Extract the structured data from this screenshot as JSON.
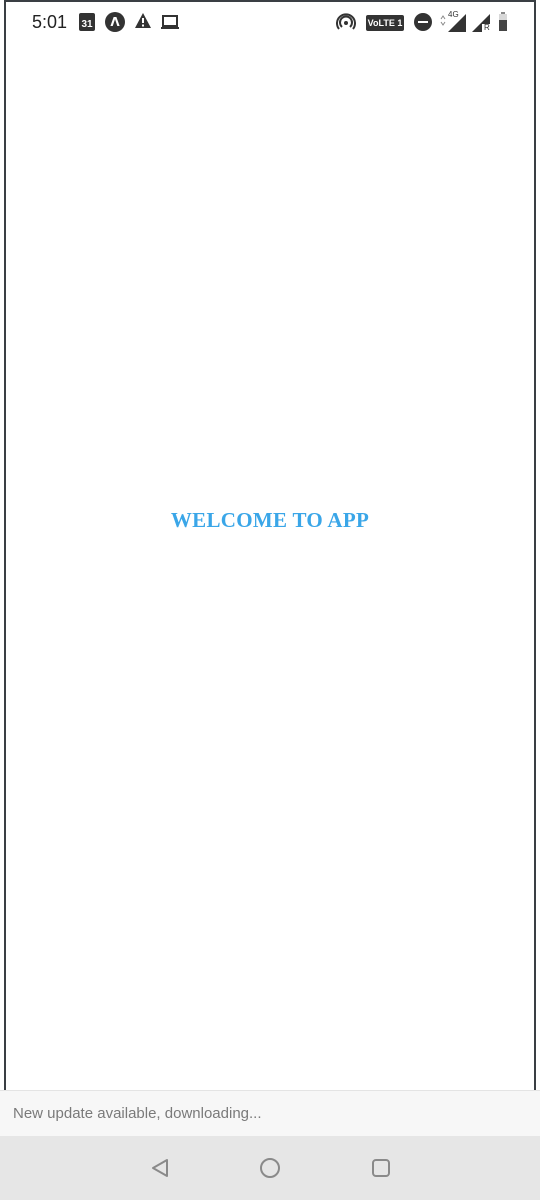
{
  "status_bar": {
    "time": "5:01",
    "calendar_day": "31",
    "volte_label": "VoLTE 1",
    "network_label": "4G",
    "roaming_label": "R",
    "icons": [
      "calendar-icon",
      "angular-icon",
      "warning-icon",
      "cast-icon",
      "hotspot-icon",
      "volte-badge",
      "dnd-icon",
      "signal-4g-icon",
      "signal-roaming-icon",
      "battery-icon"
    ]
  },
  "main": {
    "welcome_text": "WELCOME TO APP",
    "welcome_color": "#3aa6e8"
  },
  "update_banner": {
    "text": "New update available, downloading..."
  },
  "nav_bar": {
    "buttons": [
      "back-icon",
      "home-icon",
      "recents-icon"
    ]
  }
}
